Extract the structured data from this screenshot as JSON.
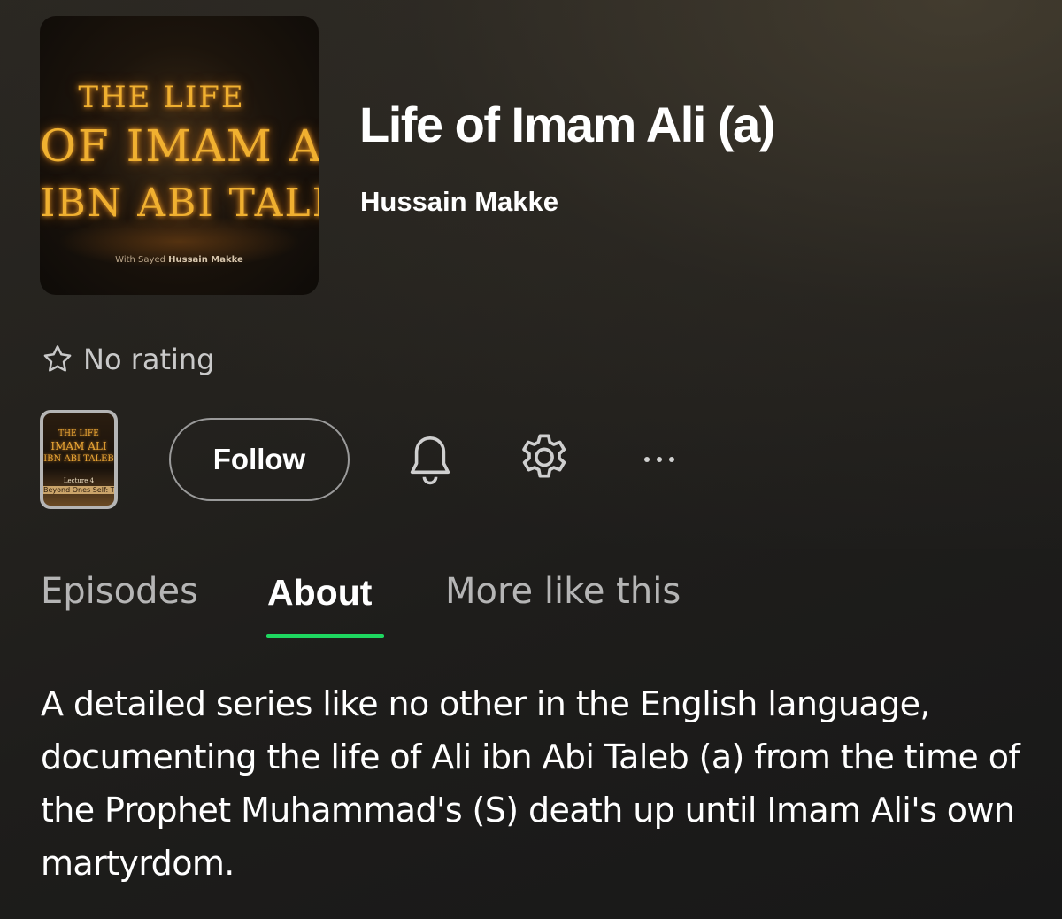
{
  "show": {
    "title": "Life of Imam Ali (a)",
    "author": "Hussain Makke",
    "cover_art": {
      "line1": "THE LIFE",
      "line2": "OF IMAM ALI",
      "line3": "IBN ABI TALEB",
      "credit_prefix": "With Sayed",
      "credit_name": "Hussain Makke"
    }
  },
  "rating": {
    "icon": "star-outline-icon",
    "text": "No rating"
  },
  "actions": {
    "episode_thumb": {
      "line1": "THE LIFE",
      "line2": "IMAM ALI",
      "line3": "IBN ABI TALEB",
      "line4": "Lecture 4",
      "line5": "Beyond Ones Self: The"
    },
    "follow_label": "Follow",
    "bell_icon": "bell-icon",
    "settings_icon": "gear-icon",
    "more_icon": "more-horizontal-icon"
  },
  "tabs": [
    {
      "label": "Episodes",
      "active": false
    },
    {
      "label": "About",
      "active": true
    },
    {
      "label": "More like this",
      "active": false
    }
  ],
  "about": {
    "description": "A detailed series like no other in the English language, documenting the life of Ali ibn Abi Taleb (a) from the time of the Prophet Muhammad's (S) death up until Imam Ali's own martyrdom."
  },
  "colors": {
    "accent": "#1ed760",
    "background": "#1e1d1b",
    "muted_text": "#b5b5b5"
  }
}
